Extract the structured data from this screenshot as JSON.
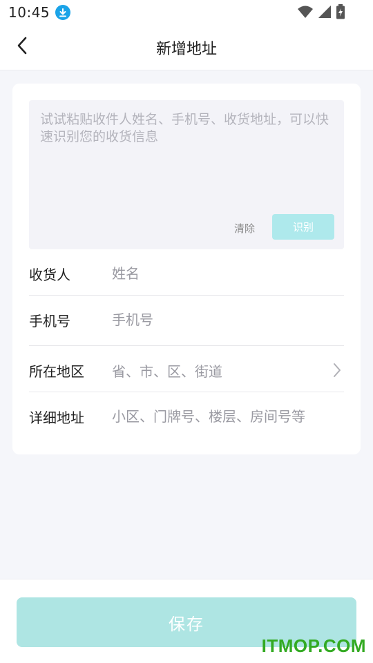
{
  "status_bar": {
    "time": "10:45",
    "icons": [
      "download-icon",
      "wifi-icon",
      "signal-icon",
      "battery-charging-icon"
    ]
  },
  "nav": {
    "title": "新增地址",
    "back_icon": "chevron-left-icon"
  },
  "paste_box": {
    "placeholder": "试试粘贴收件人姓名、手机号、收货地址，可以快速识别您的收货信息",
    "value": "",
    "clear_label": "清除",
    "recognize_label": "识别"
  },
  "form": {
    "name": {
      "label": "收货人",
      "placeholder": "姓名",
      "value": ""
    },
    "phone": {
      "label": "手机号",
      "placeholder": "手机号",
      "value": ""
    },
    "region": {
      "label": "所在地区",
      "placeholder": "省、市、区、街道"
    },
    "detail": {
      "label": "详细地址",
      "placeholder": "小区、门牌号、楼层、房间号等",
      "value": ""
    }
  },
  "bottom": {
    "save_label": "保存"
  },
  "watermark": "ITMOP.COM",
  "colors": {
    "accent_disabled": "#aee5e3",
    "download_badge": "#1aa3e8",
    "watermark": "#33aa22"
  }
}
